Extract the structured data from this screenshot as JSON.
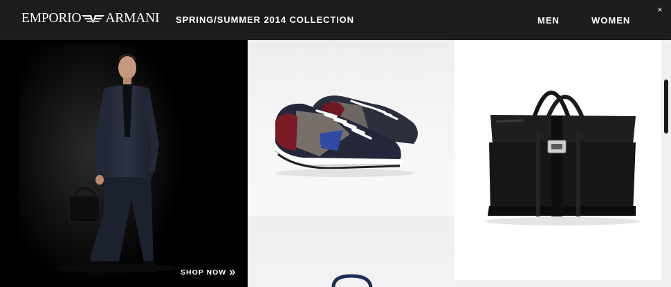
{
  "header": {
    "logo_left": "EMPORIO",
    "logo_right": "ARMANI",
    "collection_title": "SPRING/SUMMER 2014 COLLECTION",
    "nav": {
      "men": "MEN",
      "women": "WOMEN"
    },
    "close_icon": "close-icon",
    "close_glyph": "×"
  },
  "hero": {
    "cta_label": "SHOP NOW",
    "cta_icon": "double-chevron-right-icon"
  },
  "products": [
    {
      "name": "sneaker",
      "icon": "sneaker-image"
    },
    {
      "name": "bag",
      "icon": "leather-bag-image"
    },
    {
      "name": "partial-product",
      "icon": "product-image"
    }
  ],
  "colors": {
    "header_bg": "#1c1c1c",
    "text": "#ffffff",
    "scroll_thumb": "#1a1a1a"
  }
}
